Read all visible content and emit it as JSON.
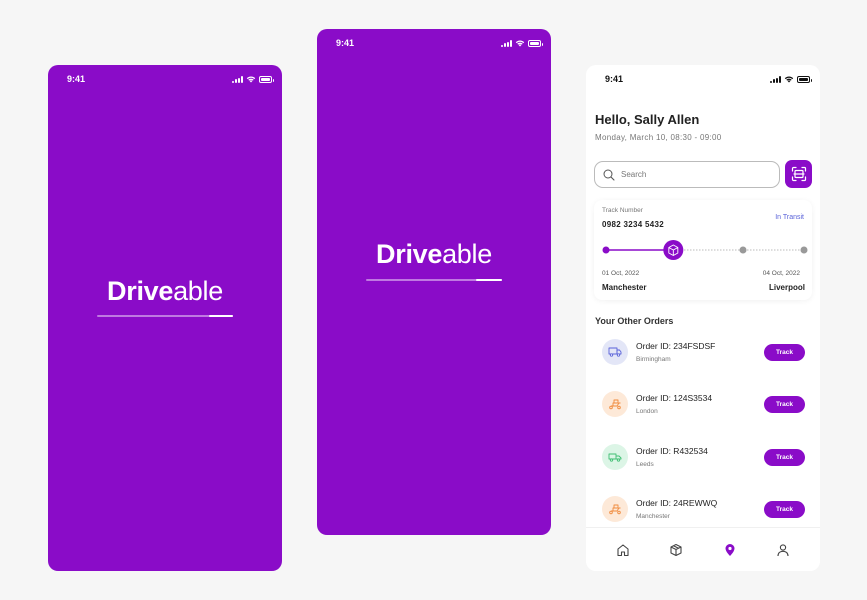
{
  "status": {
    "time": "9:41"
  },
  "splash": {
    "logo_bold": "Drive",
    "logo_light": "able",
    "progress_1": 0.18,
    "progress_2": 0.19
  },
  "home": {
    "greeting": "Hello, Sally Allen",
    "date": "Monday, March 10, 08:30 - 09:00",
    "search": {
      "placeholder": "Search"
    },
    "tracking": {
      "label": "Track Number",
      "number": "0982 3234 5432",
      "status": "In Transit",
      "from_date": "01 Oct, 2022",
      "to_date": "04 Oct, 2022",
      "from_city": "Manchester",
      "to_city": "Liverpool",
      "progress": 0.34
    },
    "section_title": "Your Other Orders",
    "orders": [
      {
        "id": "Order ID: 234FSDSF",
        "city": "Birmingham",
        "button": "Track",
        "icon": "truck-icon",
        "icon_color": "#5a63d9",
        "bg": "#e3e6f7"
      },
      {
        "id": "Order ID: 124S3534",
        "city": "London",
        "button": "Track",
        "icon": "scooter-icon",
        "icon_color": "#f08a3c",
        "bg": "#fde9d8"
      },
      {
        "id": "Order ID: R432534",
        "city": "Leeds",
        "button": "Track",
        "icon": "van-icon",
        "icon_color": "#3fbf73",
        "bg": "#dcf5e6"
      },
      {
        "id": "Order ID: 24REWWQ",
        "city": "Manchester",
        "button": "Track",
        "icon": "scooter-icon",
        "icon_color": "#f08a3c",
        "bg": "#fde9d8"
      }
    ],
    "tabs": [
      "home-icon",
      "package-icon",
      "location-pin-icon",
      "user-icon"
    ],
    "accent": "#8a0cc8"
  }
}
